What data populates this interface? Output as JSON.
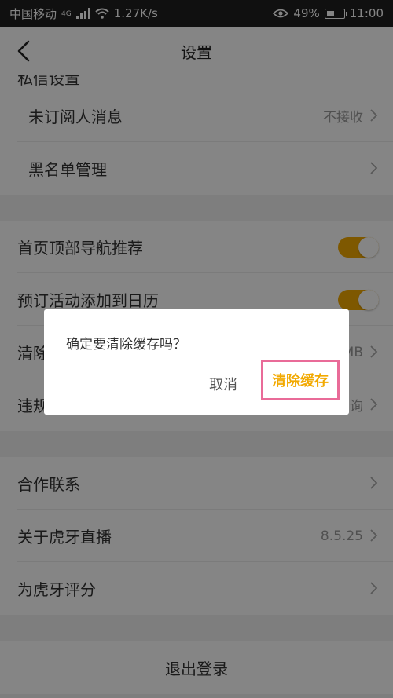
{
  "status_bar": {
    "carrier": "中国移动",
    "network": "4G",
    "speed": "1.27K/s",
    "battery": "49%",
    "battery_level": 0.49,
    "time": "11:00"
  },
  "header": {
    "title": "设置"
  },
  "sections": {
    "privacy_partial_title": "私信设置",
    "unsubscribed_messages": {
      "label": "未订阅人消息",
      "value": "不接收"
    },
    "blacklist": {
      "label": "黑名单管理"
    },
    "homepage_nav": {
      "label": "首页顶部导航推荐",
      "on": true
    },
    "calendar": {
      "label": "预订活动添加到日历",
      "on": true
    },
    "clear_cache": {
      "label": "清除缓存",
      "value": "MB"
    },
    "violation": {
      "label": "违规",
      "value": "询"
    },
    "cooperation": {
      "label": "合作联系"
    },
    "about": {
      "label": "关于虎牙直播",
      "value": "8.5.25"
    },
    "rate": {
      "label": "为虎牙评分"
    }
  },
  "logout": {
    "label": "退出登录"
  },
  "dialog": {
    "message": "确定要清除缓存吗？",
    "cancel": "取消",
    "confirm": "清除缓存"
  },
  "colors": {
    "accent": "#f2a900",
    "highlight": "#e96b98"
  }
}
